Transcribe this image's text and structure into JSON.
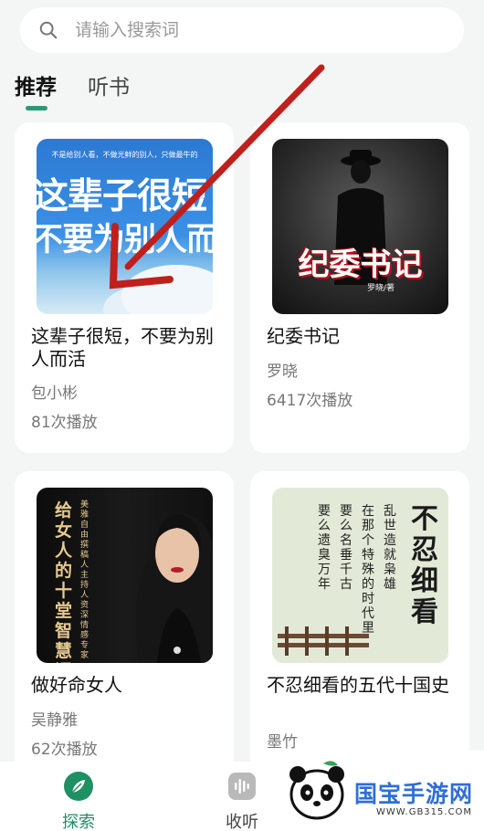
{
  "search": {
    "placeholder": "请输入搜索词"
  },
  "tabs": [
    {
      "label": "推荐",
      "active": true
    },
    {
      "label": "听书",
      "active": false
    }
  ],
  "cards": [
    {
      "title": "这辈子很短，不要为别人而活",
      "author": "包小彬",
      "plays": "81次播放",
      "cover": {
        "top_text": "不是给别人看，不做光鲜的别人，只做最牛的",
        "line1": "这辈子很短",
        "line2": "不要为别人而活"
      }
    },
    {
      "title": "纪委书记",
      "author": "罗晓",
      "plays": "6417次播放",
      "cover": {
        "title": "纪委书记",
        "author": "罗晓/著"
      }
    },
    {
      "title": "做好命女人",
      "author": "吴静雅",
      "plays": "62次播放",
      "cover": {
        "title": "给女人的十堂智慧课",
        "subtitle": "美雅 自由撰稿人 主持人 资深情感专家"
      }
    },
    {
      "title": "不忍细看的五代十国史",
      "author": "墨竹",
      "plays": "",
      "cover": {
        "title": "不忍细看",
        "col1": "乱世造就枭雄",
        "col2": "在那个特殊的时代里",
        "col3": "要么名垂千古",
        "col4": "要么遗臭万年"
      }
    }
  ],
  "bottom_nav": [
    {
      "label": "探索",
      "icon": "compass-leaf-icon",
      "active": true
    },
    {
      "label": "收听",
      "icon": "audio-wave-icon",
      "active": false
    }
  ],
  "watermark": {
    "text": "国宝手游网",
    "url": "WWW.GB315.COM"
  },
  "colors": {
    "accent": "#1f8f64",
    "arrow": "#c0201c",
    "background": "#f4f5f5"
  }
}
